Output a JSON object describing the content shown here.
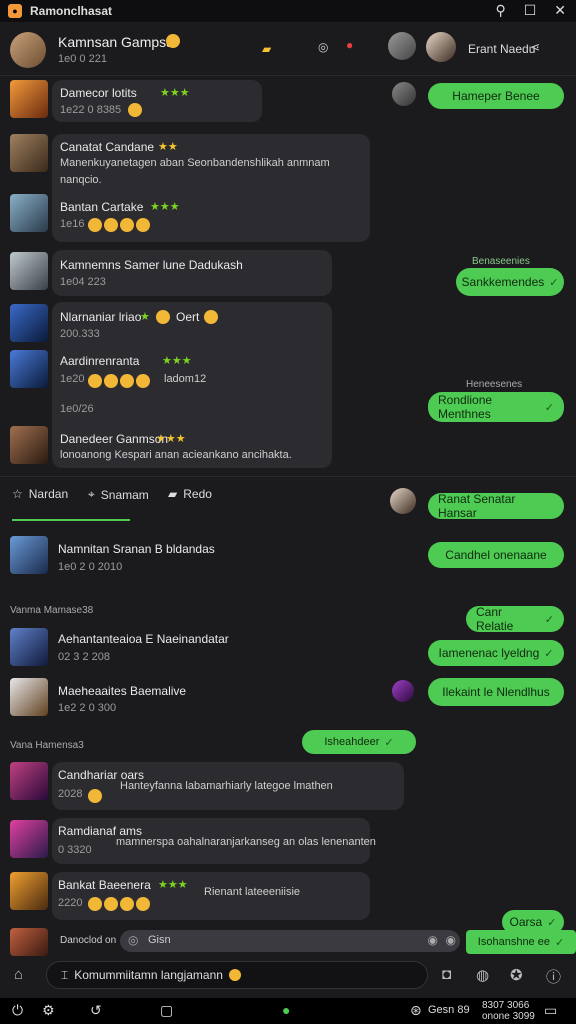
{
  "window": {
    "title": "Ramonclhasat"
  },
  "header": {
    "contact_name": "Kamnsan Gampsar",
    "contact_sub": "1e0 0 221",
    "peer_name": "Erant Naedu"
  },
  "messages_top": [
    {
      "name": "Damecor lotits",
      "meta": "1e22 0 8385"
    },
    {
      "name": "Canatat Candane",
      "text1": "Manenkuyanetagen aban Seonbandenshlikah anmnam",
      "text2": "nanqcio."
    },
    {
      "name": "Bantan Cartake",
      "meta": "1e16"
    },
    {
      "name": "Kamnemns Samer lune Dadukash",
      "meta": "1e04 223"
    },
    {
      "name": "Nlarnaniar lriao",
      "tail": "Oert",
      "meta": "200.333"
    },
    {
      "name": "Aardinrenranta",
      "meta": "1e20",
      "meta_tail": "ladom12"
    },
    {
      "meta": "1e0/26"
    },
    {
      "name": "Danedeer Ganmson",
      "text1": "lonoanong Kespari anan acieankano ancihakta."
    }
  ],
  "replies_top": [
    {
      "text": "Hameper Benee"
    },
    {
      "label": "Benaseenies",
      "text": "Sankkemendes"
    },
    {
      "label": "Heneesenes",
      "text": "Rondlione Menthnes"
    }
  ],
  "tabs": [
    {
      "label": "Nardan"
    },
    {
      "label": "Snamam"
    },
    {
      "label": "Redo"
    }
  ],
  "messages_bottom": [
    {
      "name": "Namnitan Sranan B bldandas",
      "meta": "1e0 2 0 2010"
    },
    {
      "section": "Vanma Mamase38"
    },
    {
      "name": "Aehantanteaioa E Naeinandatar",
      "meta": "02 3 2 208"
    },
    {
      "name": "Maeheaaites Baemalive",
      "meta": "1e2 2 0 300"
    },
    {
      "section": "Vana Hamensa3"
    },
    {
      "name": "Candhariar oars",
      "meta": "2028",
      "text1": "Hanteyfanna labamarhiarly lategoe lmathen"
    },
    {
      "name": "Ramdianaf ams",
      "meta": "0 3320",
      "text1": "mamnerspa oahalnaranjarkanseg an olas lenenanten"
    },
    {
      "name": "Bankat Baeenera",
      "meta": "2220",
      "text1": "Rienant lateeeniisie"
    },
    {
      "name": "Danoclod on"
    }
  ],
  "replies_bottom": [
    {
      "text": "Ranat Senatar Hansar"
    },
    {
      "text": "Candhel onenaane"
    },
    {
      "text": "Canr Relatie"
    },
    {
      "text": "Iamenenac lyeldng"
    },
    {
      "text": "Ilekaint le Nlendlhus"
    },
    {
      "text": "Isheahdeer"
    },
    {
      "text": "Oarsa"
    },
    {
      "text": "Isohanshne ee"
    }
  ],
  "input": {
    "placeholder": "Gisn"
  },
  "composer": {
    "text": "Komummiitamn langjamann"
  },
  "statusbar": {
    "clock": "Gesn 89",
    "date1": "8307 3066",
    "date2": "onone 3099"
  },
  "colors": {
    "accent": "#4ecb52",
    "bg": "#1b1b1e",
    "bubble": "#2b2b30"
  }
}
